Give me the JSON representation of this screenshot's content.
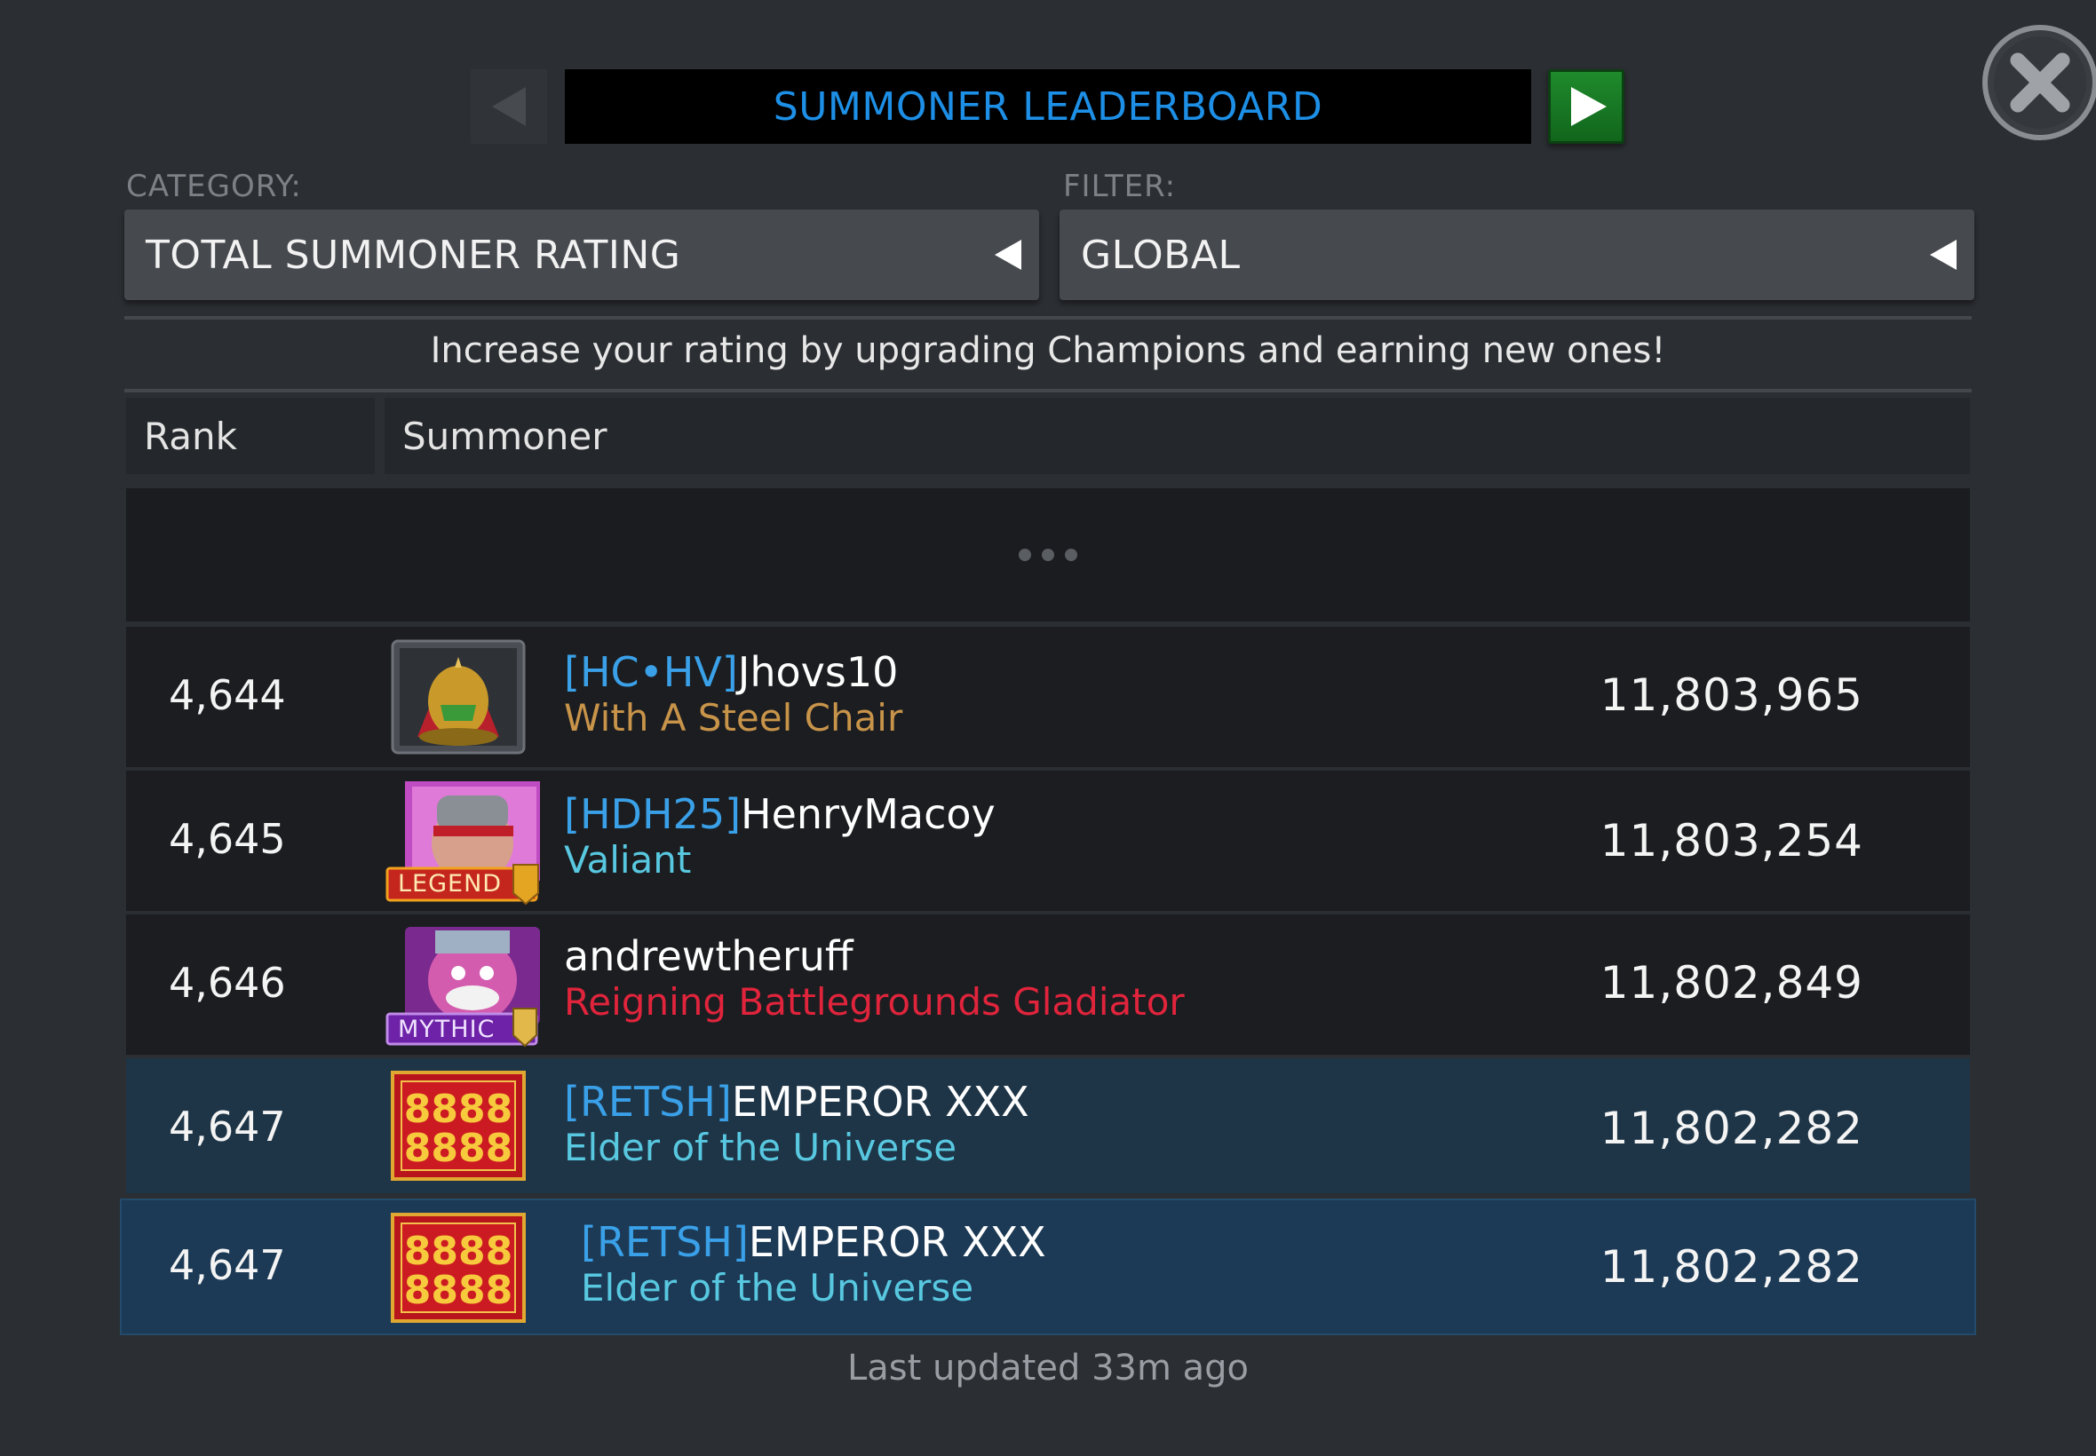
{
  "header": {
    "title": "SUMMONER LEADERBOARD",
    "prev_icon": "triangle-left-icon",
    "next_icon": "triangle-right-icon",
    "close_icon": "close-x-icon",
    "accent_color": "#1d8fe6",
    "next_color": "#1a7d26"
  },
  "category": {
    "label": "CATEGORY:",
    "value": "TOTAL SUMMONER RATING"
  },
  "filter": {
    "label": "FILTER:",
    "value": "GLOBAL"
  },
  "hint": "Increase your rating by upgrading Champions and earning new ones!",
  "columns": {
    "rank": "Rank",
    "summoner": "Summoner"
  },
  "rows": [
    {
      "rank": "4,644",
      "tag": "[HC•HV]",
      "name": "Jhovs10",
      "title": "With A Steel Chair",
      "title_color": "#c8944a",
      "rating": "11,803,965",
      "avatar_icon": "golden-helmet-avatar",
      "badge": ""
    },
    {
      "rank": "4,645",
      "tag": "[HDH25]",
      "name": "HenryMacoy",
      "title": "Valiant",
      "title_color": "#58c8e0",
      "rating": "11,803,254",
      "avatar_icon": "warrior-avatar",
      "badge": "LEGEND"
    },
    {
      "rank": "4,646",
      "tag": "",
      "name": "andrewtheruff",
      "title": "Reigning Battlegrounds Gladiator",
      "title_color": "#e0243c",
      "rating": "11,802,849",
      "avatar_icon": "pink-creature-avatar",
      "badge": "MYTHIC"
    },
    {
      "rank": "4,647",
      "tag": "[RETSH]",
      "name": "EMPEROR XXX",
      "title": "Elder of the Universe",
      "title_color": "#58c8e0",
      "rating": "11,802,282",
      "avatar_icon": "8888-avatar",
      "badge": ""
    }
  ],
  "self_row": {
    "rank": "4,647",
    "tag": "[RETSH]",
    "name": "EMPEROR XXX",
    "title": "Elder of the Universe",
    "title_color": "#58c8e0",
    "rating": "11,802,282",
    "avatar_icon": "8888-avatar"
  },
  "footer": "Last updated 33m ago"
}
